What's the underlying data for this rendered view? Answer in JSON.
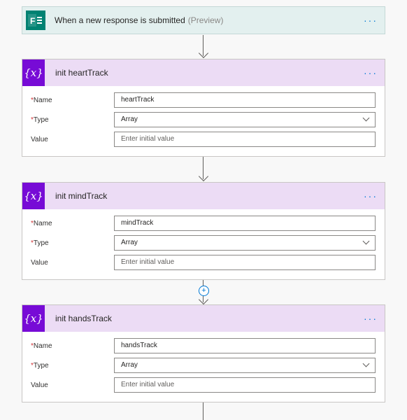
{
  "trigger": {
    "title": "When a new response is submitted",
    "preview": "(Preview)",
    "menu_label": "···",
    "icon": "forms-icon",
    "icon_letter": "F"
  },
  "steps": [
    {
      "title": "init heartTrack",
      "icon_label": "{x}",
      "menu_label": "···",
      "fields": {
        "name_label": "Name",
        "name_value": "heartTrack",
        "type_label": "Type",
        "type_value": "Array",
        "value_label": "Value",
        "value_placeholder": "Enter initial value"
      }
    },
    {
      "title": "init mindTrack",
      "icon_label": "{x}",
      "menu_label": "···",
      "fields": {
        "name_label": "Name",
        "name_value": "mindTrack",
        "type_label": "Type",
        "type_value": "Array",
        "value_label": "Value",
        "value_placeholder": "Enter initial value"
      }
    },
    {
      "title": "init handsTrack",
      "icon_label": "{x}",
      "menu_label": "···",
      "fields": {
        "name_label": "Name",
        "name_value": "handsTrack",
        "type_label": "Type",
        "type_value": "Array",
        "value_label": "Value",
        "value_placeholder": "Enter initial value"
      }
    }
  ],
  "required_mark": "*",
  "add_step_label": "+",
  "colors": {
    "trigger_bg": "#e3f0ef",
    "forms_green": "#008272",
    "variable_purple": "#770bd6",
    "variable_header_bg": "#ecdcf5",
    "accent_blue": "#0078d4",
    "required_red": "#d13438"
  }
}
